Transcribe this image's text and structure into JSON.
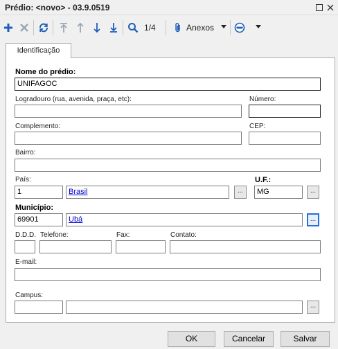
{
  "window": {
    "title": "Prédio: <novo> - 03.9.0519"
  },
  "toolbar": {
    "record_counter": "1/4",
    "attachments_label": "Anexos"
  },
  "tabs": [
    {
      "label": "Identificação"
    }
  ],
  "form": {
    "nome_label": "Nome do prédio:",
    "nome_value": "UNIFAGOC",
    "logradouro_label": "Logradouro (rua, avenida, praça, etc):",
    "logradouro_value": "",
    "numero_label": "Número:",
    "numero_value": "",
    "complemento_label": "Complemento:",
    "complemento_value": "",
    "cep_label": "CEP:",
    "cep_value": "",
    "bairro_label": "Bairro:",
    "bairro_value": "",
    "pais_label": "País:",
    "pais_code": "1",
    "pais_name": "Brasil",
    "uf_label": "U.F.:",
    "uf_value": "MG",
    "municipio_label": "Município:",
    "municipio_code": "69901",
    "municipio_name": "Ubá",
    "ddd_label": "D.D.D.",
    "ddd_value": "",
    "telefone_label": "Telefone:",
    "telefone_value": "",
    "fax_label": "Fax:",
    "fax_value": "",
    "contato_label": "Contato:",
    "contato_value": "",
    "email_label": "E-mail:",
    "email_value": "",
    "campus_label": "Campus:",
    "campus_code": "",
    "campus_name": "",
    "lookup_label": "..."
  },
  "buttons": {
    "ok": "OK",
    "cancel": "Cancelar",
    "save": "Salvar"
  },
  "colors": {
    "accent_blue": "#1f5fb8",
    "link": "#0000cc"
  }
}
